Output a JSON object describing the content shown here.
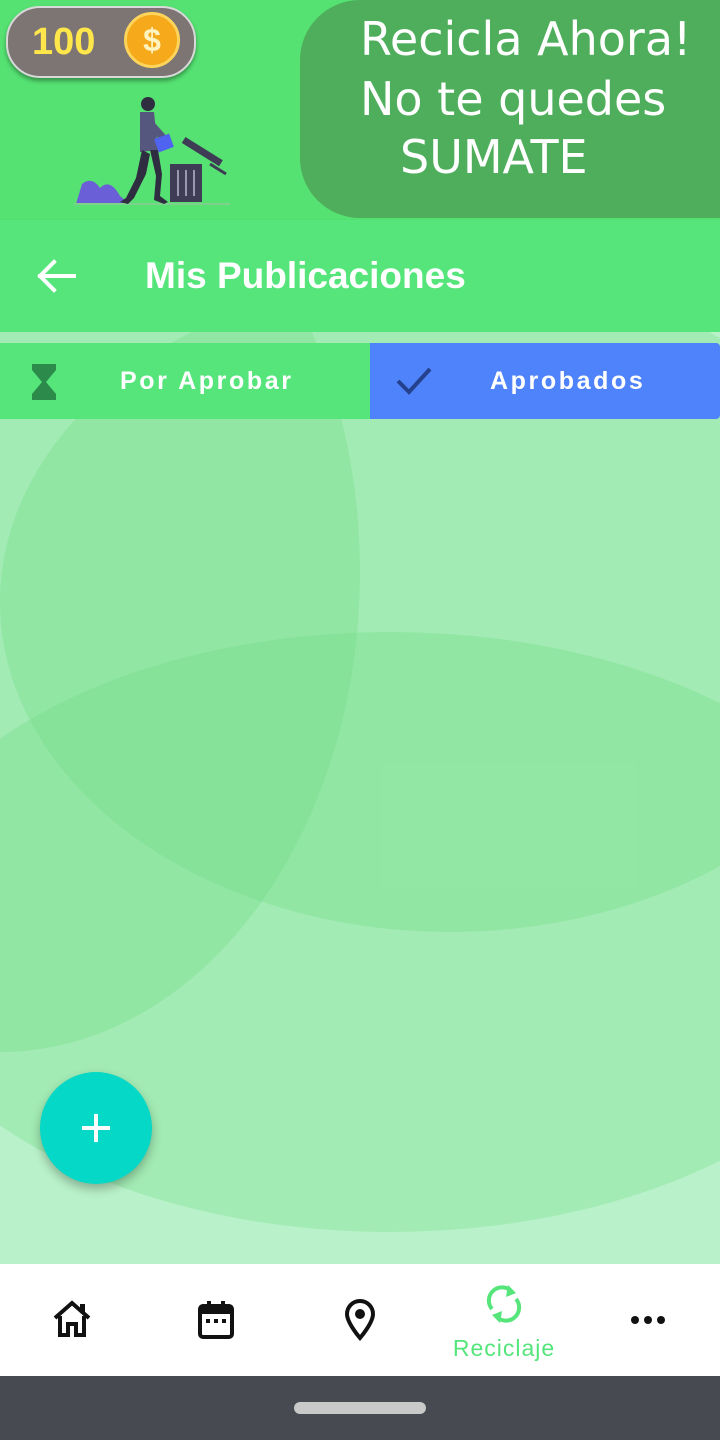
{
  "banner": {
    "coins": "100",
    "coin_symbol": "$",
    "promo_lines": [
      "Recicla Ahora!",
      "No te quedes",
      "SUMATE"
    ]
  },
  "appbar": {
    "title": "Mis Publicaciones",
    "back_icon": "arrow-left-icon"
  },
  "tabs": [
    {
      "label": "Por Aprobar",
      "icon": "hourglass-icon",
      "selected": false
    },
    {
      "label": "Aprobados",
      "icon": "check-icon",
      "selected": true
    }
  ],
  "fab": {
    "icon": "plus-icon"
  },
  "bottom_nav": {
    "items": [
      {
        "icon": "home-icon",
        "label": "",
        "active": false
      },
      {
        "icon": "calendar-icon",
        "label": "",
        "active": false
      },
      {
        "icon": "location-pin-icon",
        "label": "",
        "active": false
      },
      {
        "icon": "recycle-icon",
        "label": "Reciclaje",
        "active": true
      },
      {
        "icon": "more-dots-icon",
        "label": "",
        "active": false
      }
    ]
  },
  "colors": {
    "banner_green": "#55e272",
    "promo_green": "#4fae5b",
    "appbar_green": "#55e57b",
    "selected_tab_blue": "#4f83fb",
    "fab_teal": "#05d8c6",
    "content_background": "#b9f2ca",
    "coin_text_yellow": "#ffe64a"
  }
}
